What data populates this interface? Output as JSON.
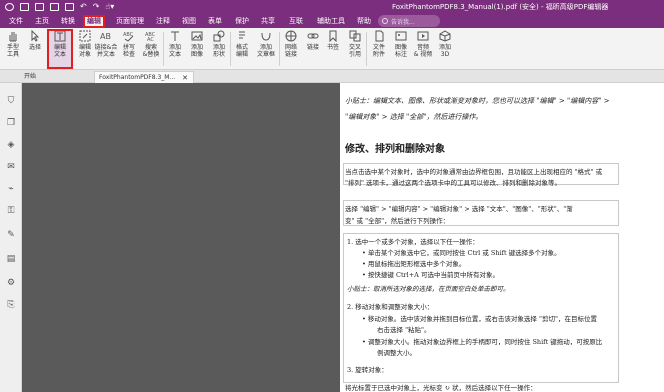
{
  "window": {
    "title": "FoxitPhantomPDF8.3_Manual(1).pdf (安全) - 福昕高级PDF编辑器"
  },
  "menu": {
    "items": [
      "文件",
      "主页",
      "转换",
      "编辑",
      "页面管理",
      "注释",
      "视图",
      "表单",
      "保护",
      "共享",
      "互联",
      "辅助工具",
      "帮助"
    ],
    "active": "编辑",
    "search_placeholder": "告诉我..."
  },
  "ribbon": {
    "tools": [
      {
        "label": "手型\n工具"
      },
      {
        "label": "选择"
      },
      {
        "label": "编辑\n文本"
      },
      {
        "label": "编辑\n对象"
      },
      {
        "label": "链接&合\n并文本"
      },
      {
        "label": "拼写\n检查"
      },
      {
        "label": "搜索\n&替换"
      },
      {
        "label": "添加\n文本"
      },
      {
        "label": "添加\n图像"
      },
      {
        "label": "添加\n形状"
      },
      {
        "label": "格式\n编辑"
      },
      {
        "label": "添加\n文章框"
      },
      {
        "label": "网络\n链接"
      },
      {
        "label": "链接"
      },
      {
        "label": "书签"
      },
      {
        "label": "交叉\n引用"
      },
      {
        "label": "文件\n附件"
      },
      {
        "label": "图像\n标注"
      },
      {
        "label": "音频\n& 视频"
      },
      {
        "label": "添加\n3D"
      }
    ],
    "selected": "编辑文本"
  },
  "tabs": {
    "home": "开始",
    "doc": "FoxitPhantomPDF8.3_M..."
  },
  "document": {
    "tip1_line1": "小贴士：编辑文本、图像、形状或渐变对象时，您也可以选择 \"编辑\" > \"编辑内容\" >",
    "tip1_line2": "\"编辑对象\"  >  选择 \"全部\"，然后进行操作。",
    "heading": "修改、排列和删除对象",
    "para1_line1": "当点击选中某个对象时，选中的对象通常由边界框包围，且功能区上出现相应的 \"格式\" 或",
    "para1_line2": "\"排列\" 选项卡，通过这两个选项卡中的工具可以修改、排列和删除对象等。",
    "para2_line1": "选择 \"编辑\" > \"编辑内容\" > \"编辑对象\"  > 选择 \"文本\"、\"图像\"、\"形状\"、\"渐",
    "para2_line2": "变\" 或 \"全部\"，然后进行下列操作：",
    "list": [
      "1.   选中一个或多个对象，选择以下任一操作：",
      "•    单击某个对象选中它，或同时按住 Ctrl 或 Shift 键选择多个对象。",
      "•    用鼠标拖出矩形框选中多个对象。",
      "•    按快捷键 Ctrl+A 可选中当前页中所有对象。",
      "小贴士：取消所选对象的选择，在页面空白处单击即可。",
      "2.   移动对象和调整对象大小：",
      "•    移动对象。选中该对象并拖到目标位置，或右击该对象选择 \"剪切\"，在目标位置",
      "右击选择 \"粘贴\"。",
      "•    调整对象大小。拖动对象边界框上的手柄即可，同时按住 Shift 键拖动，可按原比",
      "例调整大小。",
      "3.   旋转对象：",
      "将光标置于已选中对象上，光标变 ↻ 状，然后选择以下任一操作："
    ]
  }
}
